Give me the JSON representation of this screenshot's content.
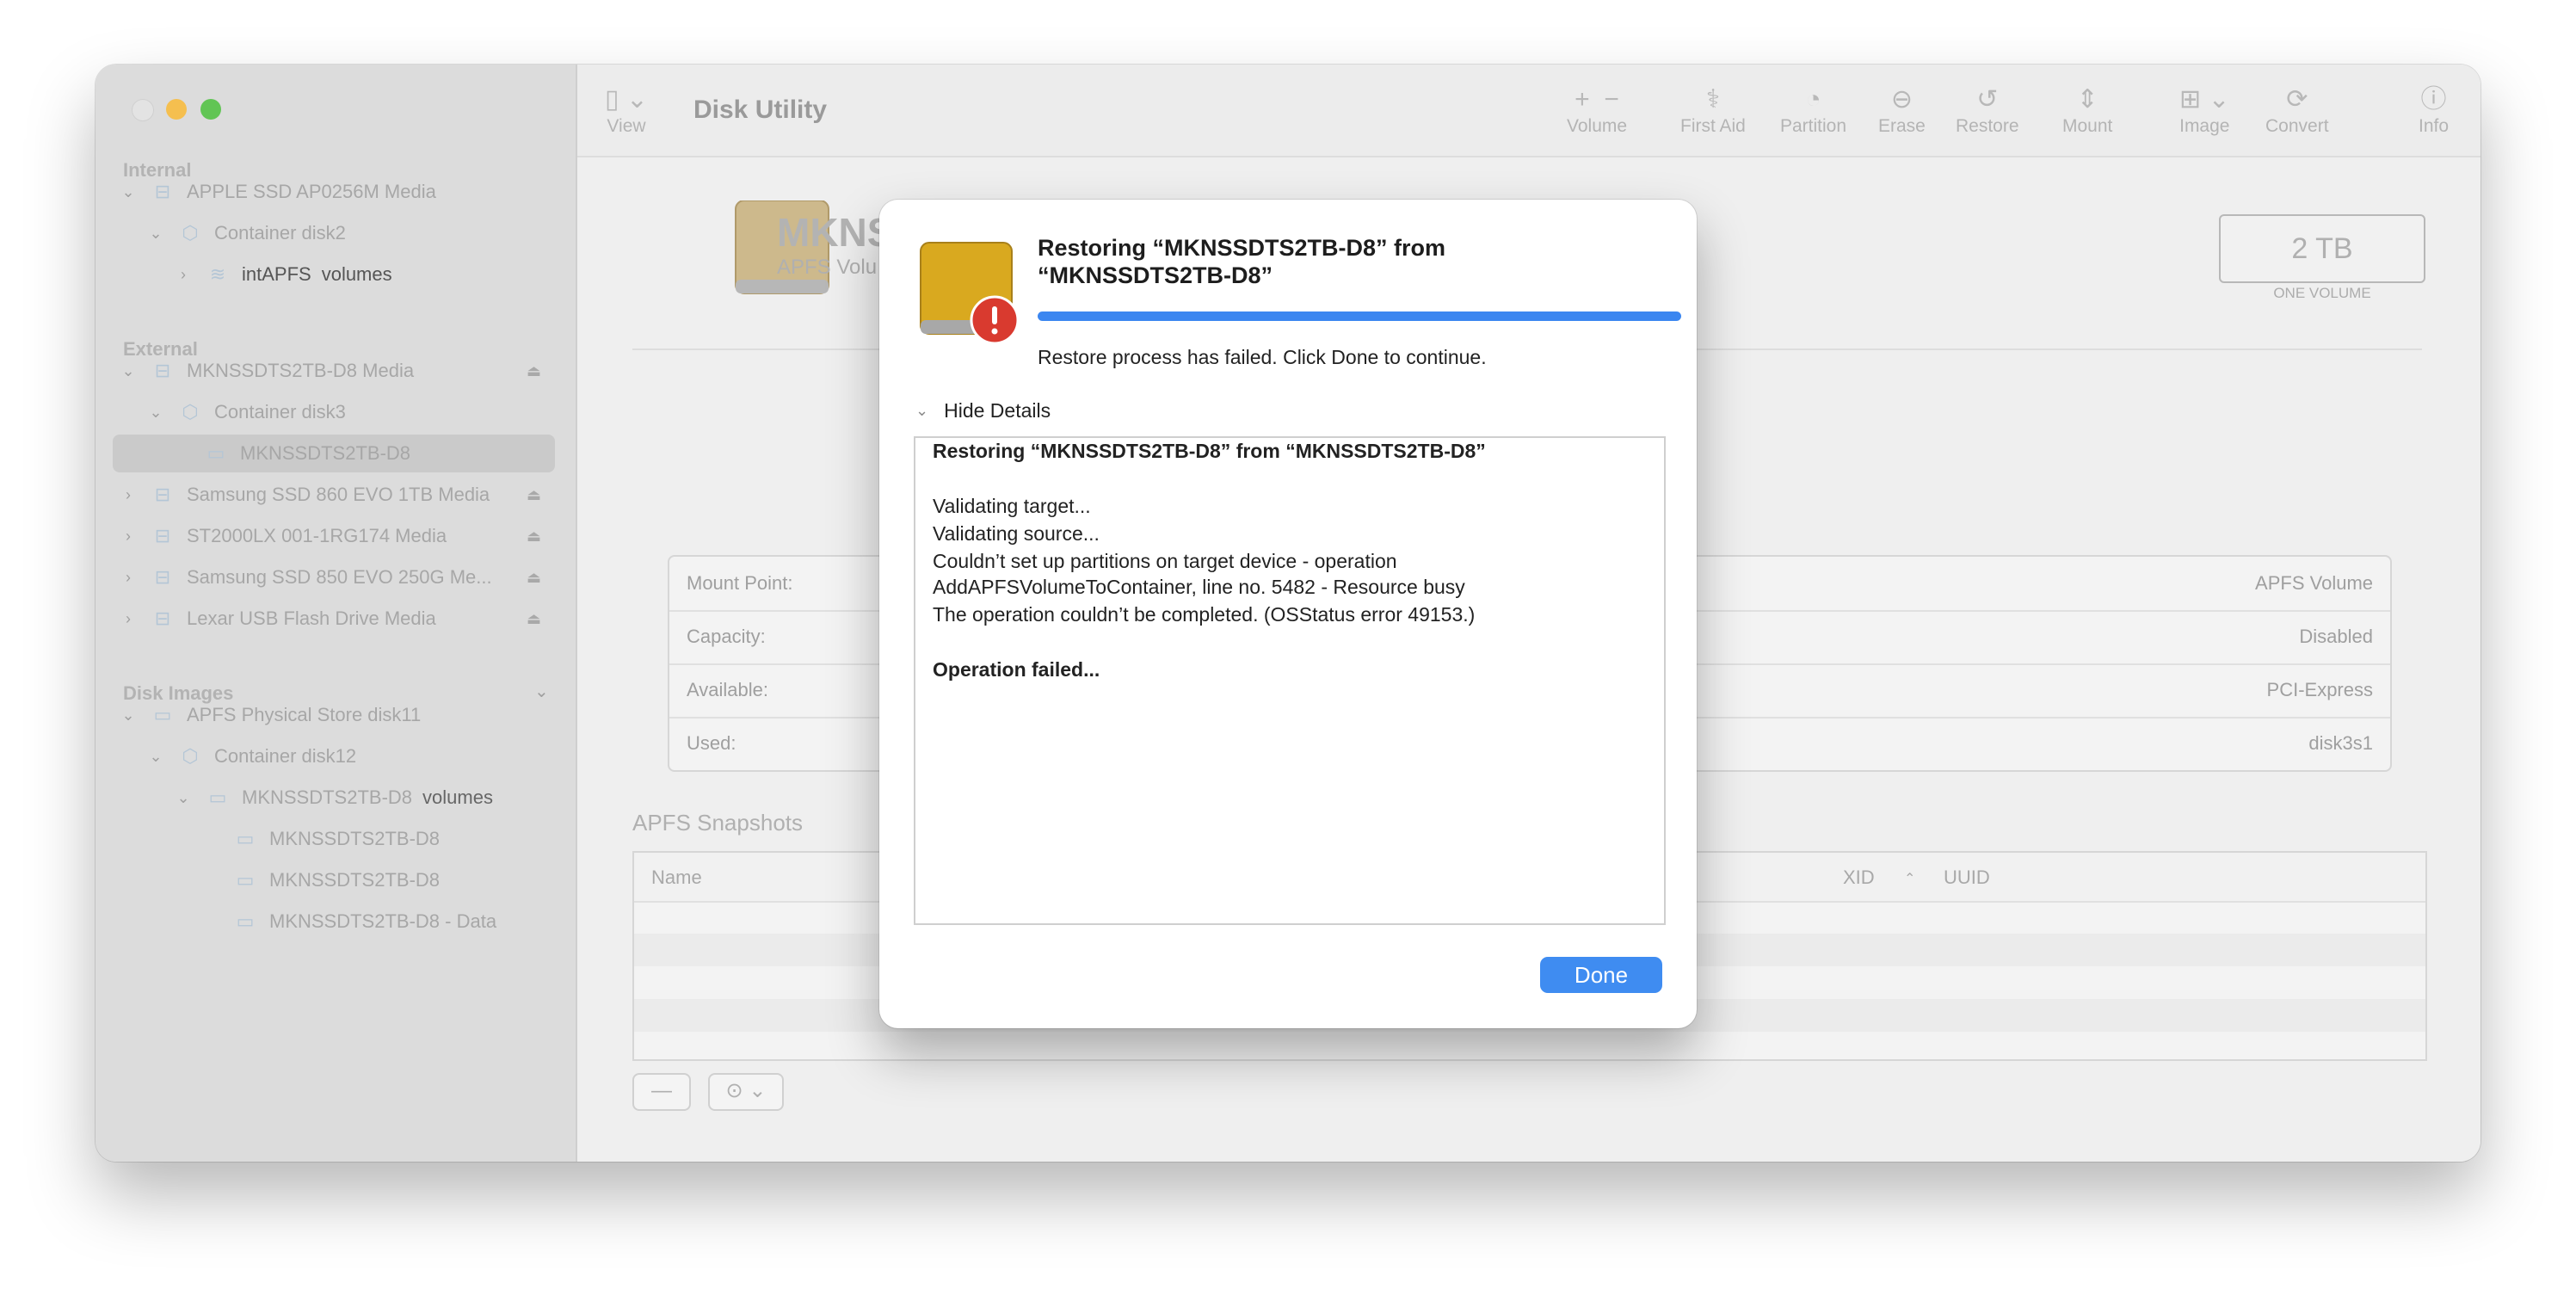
{
  "window": {
    "title": "Disk Utility"
  },
  "sidebar": {
    "sections": {
      "internal": "Internal",
      "external": "External",
      "disk_images": "Disk Images"
    },
    "items": [
      {
        "label": "APPLE SSD AP0256M Media"
      },
      {
        "label": "Container disk2"
      },
      {
        "label": "intAPFS",
        "suffix": "volumes"
      },
      {
        "label": "MKNSSDTS2TB-D8 Media"
      },
      {
        "label": "Container disk3"
      },
      {
        "label": "MKNSSDTS2TB-D8"
      },
      {
        "label": "Samsung SSD 860 EVO 1TB Media"
      },
      {
        "label": "ST2000LX 001-1RG174 Media"
      },
      {
        "label": "Samsung SSD 850 EVO 250G Me..."
      },
      {
        "label": "Lexar USB Flash Drive Media"
      },
      {
        "label": "APFS Physical Store disk11"
      },
      {
        "label": "Container disk12"
      },
      {
        "label": "MKNSSDTS2TB-D8",
        "suffix": "volumes"
      },
      {
        "label": "MKNSSDTS2TB-D8"
      },
      {
        "label": "MKNSSDTS2TB-D8"
      },
      {
        "label": "MKNSSDTS2TB-D8 - Data"
      }
    ]
  },
  "toolbar": {
    "view": "View",
    "volume": "Volume",
    "first_aid": "First Aid",
    "partition": "Partition",
    "erase": "Erase",
    "restore": "Restore",
    "mount": "Mount",
    "image": "Image",
    "convert": "Convert",
    "info": "Info"
  },
  "volume": {
    "name": "MKNS",
    "subtitle": "APFS Volu",
    "size": "2 TB",
    "size_sub": "ONE VOLUME"
  },
  "info": {
    "rows": [
      {
        "key": "Mount Point:",
        "value": "APFS Volume"
      },
      {
        "key": "Capacity:",
        "value": "Disabled"
      },
      {
        "key": "Available:",
        "value": "PCI-Express"
      },
      {
        "key": "Used:",
        "value": "disk3s1"
      }
    ]
  },
  "snapshots": {
    "title": "APFS Snapshots",
    "columns": {
      "name": "Name",
      "xid": "XID",
      "uuid": "UUID"
    }
  },
  "dialog": {
    "title_line1": "Restoring “MKNSSDTS2TB-D8” from",
    "title_line2": "“MKNSSDTS2TB-D8”",
    "progress": 1.0,
    "status": "Restore process has failed. Click Done to continue.",
    "hide_details": "Hide Details",
    "details": {
      "heading": "Restoring “MKNSSDTS2TB-D8” from “MKNSSDTS2TB-D8”",
      "lines": [
        "Validating target...",
        "Validating source...",
        "Couldn’t set up partitions on target device - operation",
        "AddAPFSVolumeToContainer, line no. 5482 - Resource busy",
        "The operation couldn’t be completed. (OSStatus error 49153.)"
      ],
      "footer": "Operation failed..."
    },
    "done_label": "Done"
  },
  "colors": {
    "accent": "#3f8cf1",
    "close": "#e9e9e9",
    "minimize": "#f5bf4f",
    "zoom": "#61c554",
    "alert": "#d93a2f"
  }
}
